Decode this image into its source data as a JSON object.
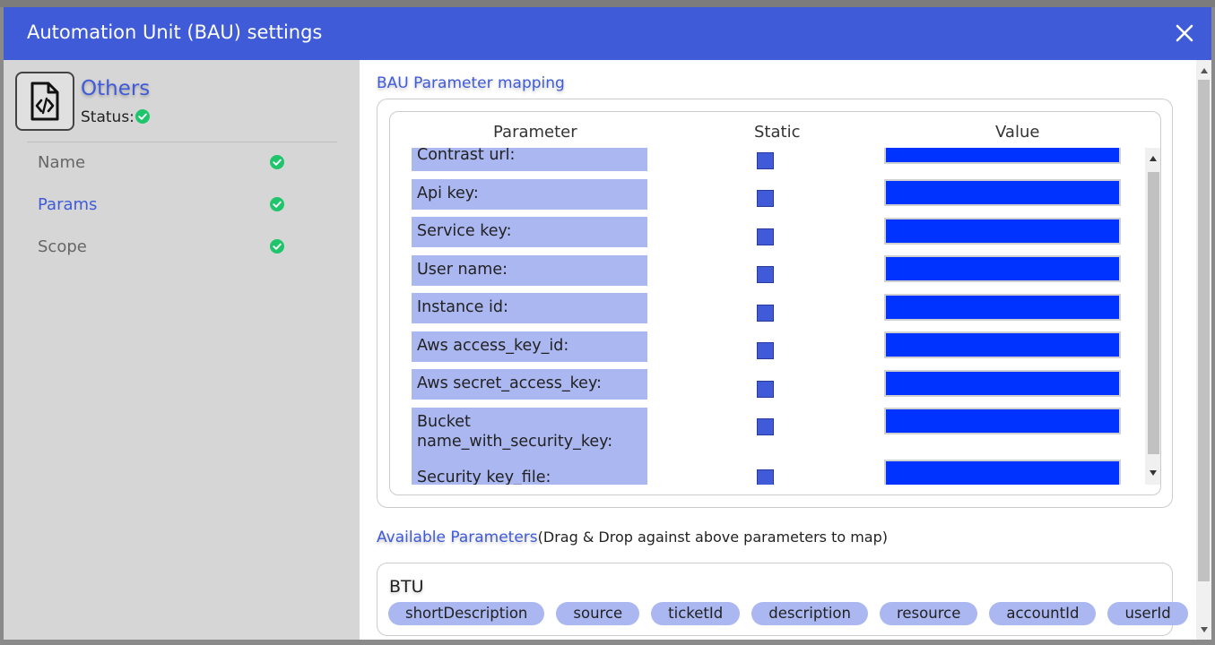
{
  "window": {
    "title": "Automation Unit (BAU) settings"
  },
  "sidebar": {
    "unit_name": "Others",
    "status_label": "Status:",
    "items": [
      {
        "label": "Name",
        "active": false
      },
      {
        "label": "Params",
        "active": true
      },
      {
        "label": "Scope",
        "active": false
      }
    ]
  },
  "mapping": {
    "title": "BAU Parameter mapping",
    "headers": {
      "parameter": "Parameter",
      "static": "Static",
      "value": "Value"
    },
    "rows": [
      {
        "label": "Contrast url:"
      },
      {
        "label": "Api key:"
      },
      {
        "label": "Service key:"
      },
      {
        "label": "User name:"
      },
      {
        "label": "Instance id:"
      },
      {
        "label": "Aws access_key_id:"
      },
      {
        "label": "Aws secret_access_key:"
      },
      {
        "label": "Bucket name_with_security_key:"
      },
      {
        "label": "Security key_file:"
      }
    ]
  },
  "available": {
    "title": "Available Parameters",
    "hint": "(Drag & Drop against above parameters to map)",
    "group": "BTU",
    "chips": [
      "shortDescription",
      "source",
      "ticketId",
      "description",
      "resource",
      "accountId",
      "userId"
    ]
  },
  "colors": {
    "accent": "#3f5bd8",
    "chip": "#aab7f0",
    "value_fill": "#0033ff",
    "success": "#1fc56b"
  }
}
